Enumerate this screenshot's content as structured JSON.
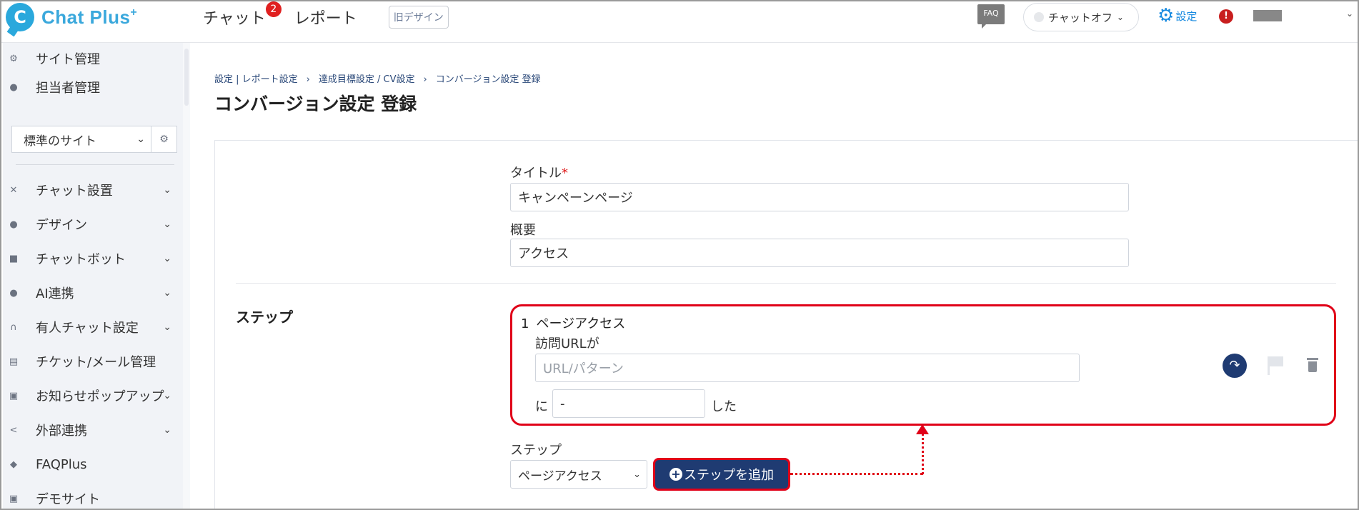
{
  "header": {
    "logo_glyph": "C",
    "logo_text": "Chat Plus",
    "logo_plus": "+",
    "nav": [
      {
        "label": "チャット",
        "badge": "2"
      },
      {
        "label": "レポート"
      }
    ],
    "old_design": "旧デザイン",
    "faq": "FAQ",
    "chat_status": "チャットオフ",
    "settings": "設定",
    "alert": "!"
  },
  "sidebar": {
    "top_items": [
      {
        "label": "サイト管理",
        "icon": "gear-icon"
      },
      {
        "label": "担当者管理",
        "icon": "user-gear-icon"
      }
    ],
    "site_select": "標準のサイト",
    "items": [
      {
        "label": "チャット設置",
        "icon": "tools-icon",
        "expandable": true
      },
      {
        "label": "デザイン",
        "icon": "palette-icon",
        "expandable": true
      },
      {
        "label": "チャットボット",
        "icon": "chat-icon",
        "expandable": true
      },
      {
        "label": "AI連携",
        "icon": "lightbulb-icon",
        "expandable": true
      },
      {
        "label": "有人チャット設定",
        "icon": "headset-icon",
        "expandable": true
      },
      {
        "label": "チケット/メール管理",
        "icon": "ticket-icon",
        "expandable": false
      },
      {
        "label": "お知らせポップアップ",
        "icon": "popup-icon",
        "expandable": true
      },
      {
        "label": "外部連携",
        "icon": "share-icon",
        "expandable": true
      },
      {
        "label": "FAQPlus",
        "icon": "faq-icon",
        "expandable": false
      },
      {
        "label": "デモサイト",
        "icon": "demo-icon",
        "expandable": false
      }
    ]
  },
  "breadcrumb": [
    "設定 | レポート設定",
    "達成目標設定 / CV設定",
    "コンバージョン設定 登録"
  ],
  "breadcrumb_sep": "›",
  "page_title": "コンバージョン設定 登録",
  "form": {
    "title_label": "タイトル",
    "required_mark": "*",
    "title_value": "キャンペーンページ",
    "summary_label": "概要",
    "summary_value": "アクセス",
    "steps_label": "ステップ",
    "step": {
      "number": "1",
      "type": "ページアクセス",
      "url_label": "訪問URLが",
      "url_placeholder": "URL/パターン",
      "ni": "に",
      "select_value": "-",
      "shita": "した"
    },
    "add_step_label": "ステップ",
    "add_step_select": "ページアクセス",
    "add_step_button": "ステップを追加"
  }
}
